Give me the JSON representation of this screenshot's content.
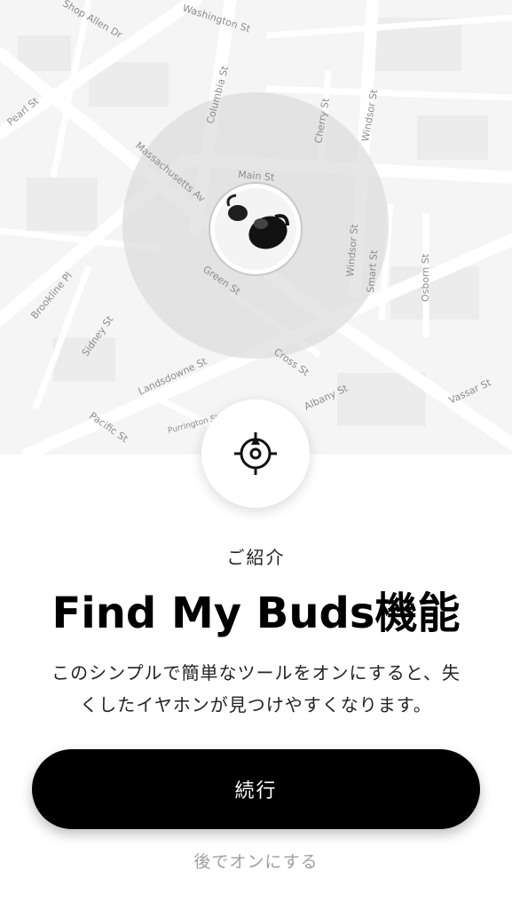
{
  "map": {
    "streets": {
      "washington": "Washington St",
      "shop_allen": "Shop Allen Dr",
      "pearl": "Pearl St",
      "columbia": "Columbia St",
      "cherry": "Cherry St",
      "windsor_top": "Windsor St",
      "massachusetts": "Massachusetts Av",
      "main": "Main St",
      "green": "Green St",
      "brookline": "Brookline Pl",
      "sidney": "Sidney St",
      "windsor_mid": "Windsor St",
      "smart": "Smart St",
      "osborn": "Osborn St",
      "landsdowne": "Landsdowne St",
      "cross": "Cross St",
      "albany": "Albany St",
      "vassar": "Vassar St",
      "purrington": "Purrington St",
      "pacific": "Pacific St"
    },
    "marker_icon": "earbuds-icon"
  },
  "locate_icon": "locate-crosshair-icon",
  "intro": {
    "eyebrow": "ご紹介",
    "title": "Find My Buds機能",
    "description_line1": "このシンプルで簡単なツールをオンにすると、失",
    "description_line2": "くしたイヤホンが見つけやすくなります。"
  },
  "actions": {
    "continue_label": "続行",
    "later_label": "後でオンにする"
  },
  "colors": {
    "map_background": "#f5f5f5",
    "radius_fill": "#dddddd",
    "primary_button": "#000000",
    "secondary_text": "#a0a0a0"
  }
}
